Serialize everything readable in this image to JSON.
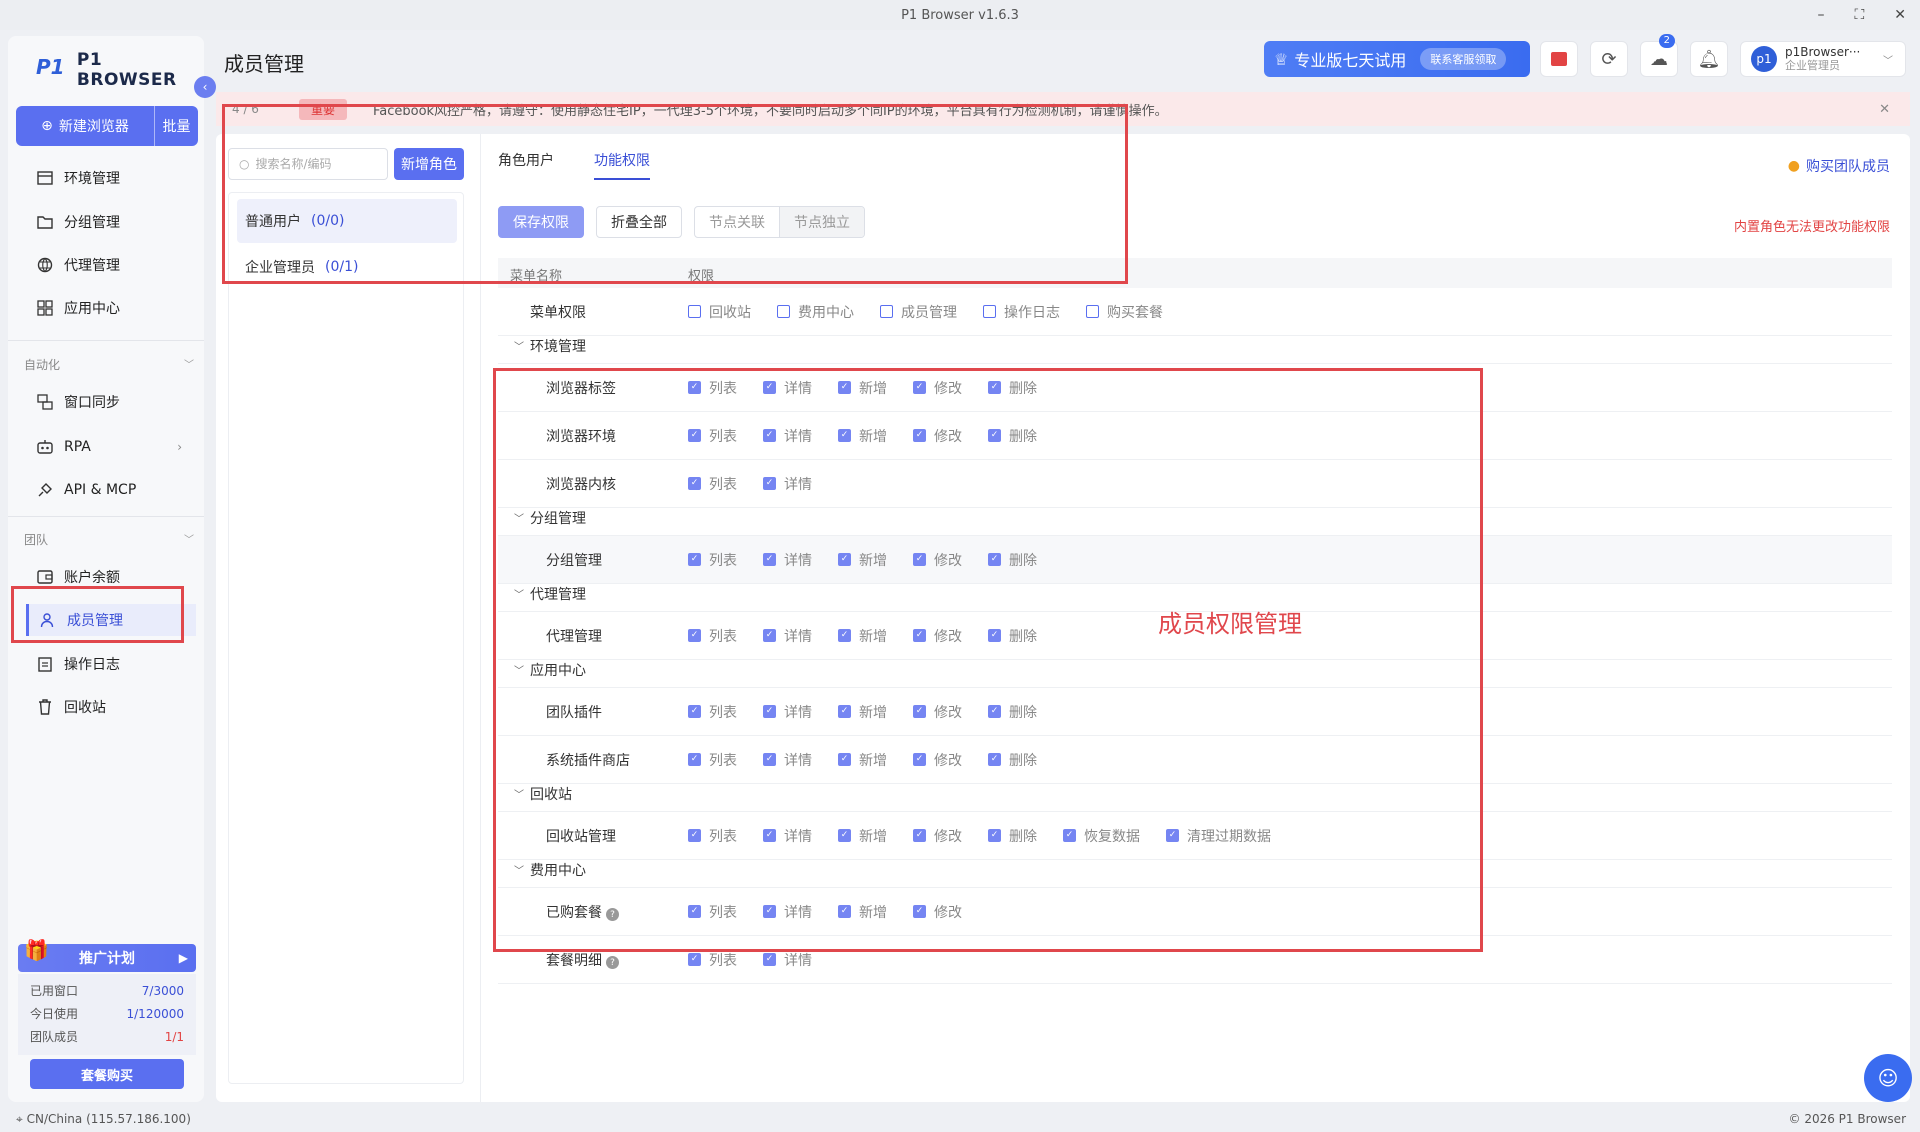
{
  "window": {
    "title": "P1 Browser v1.6.3",
    "min": "–",
    "max": "⛶",
    "close": "✕"
  },
  "sidebar": {
    "logo_text": "P1 BROWSER",
    "logo_mark": "P1",
    "new_browser": "新建浏览器",
    "batch": "批量",
    "items": [
      {
        "label": "环境管理",
        "icon": "browser-icon"
      },
      {
        "label": "分组管理",
        "icon": "folder-icon"
      },
      {
        "label": "代理管理",
        "icon": "globe-icon"
      },
      {
        "label": "应用中心",
        "icon": "grid-icon"
      }
    ],
    "automation": {
      "label": "自动化",
      "items": [
        "窗口同步",
        "RPA",
        "API & MCP"
      ]
    },
    "team": {
      "label": "团队",
      "items": [
        "账户余额",
        "成员管理",
        "操作日志",
        "回收站"
      ]
    },
    "promo": {
      "title": "推广计划",
      "rows": [
        {
          "k": "已用窗口",
          "v": "7/3000"
        },
        {
          "k": "今日使用",
          "v": "1/120000"
        },
        {
          "k": "团队成员",
          "v": "1/1"
        }
      ],
      "buy": "套餐购买"
    }
  },
  "header": {
    "title": "成员管理",
    "trial": "专业版七天试用",
    "contact": "联系客服领取",
    "cloud_badge": "2",
    "user_name": "p1Browser···",
    "user_role": "企业管理员",
    "avatar": "p1"
  },
  "notice": {
    "index": "4 / 6",
    "tag": "重要",
    "message": "Facebook风控严格，请遵守：使用静态住宅IP，一代理3-5个环境，不要同时启动多个同IP的环境，平台具有行为检测机制，请谨慎操作。",
    "close": "✕"
  },
  "roles": {
    "search_placeholder": "搜索名称/编码",
    "add_role": "新增角色",
    "list": [
      {
        "name": "普通用户",
        "count": "(0/0)"
      },
      {
        "name": "企业管理员",
        "count": "(0/1)"
      }
    ]
  },
  "tabs": [
    "角色用户",
    "功能权限"
  ],
  "buy_team": "购买团队成员",
  "toolbar": {
    "save": "保存权限",
    "collapse": "折叠全部",
    "link": "节点关联",
    "independent": "节点独立"
  },
  "warning": "内置角色无法更改功能权限",
  "perm_header": {
    "menu": "菜单名称",
    "perm": "权限"
  },
  "perms": {
    "menu_row": {
      "label": "菜单权限",
      "opts": [
        "回收站",
        "费用中心",
        "成员管理",
        "操作日志",
        "购买套餐"
      ]
    },
    "groups": [
      {
        "name": "环境管理",
        "rows": [
          {
            "label": "浏览器标签",
            "opts": [
              "列表",
              "详情",
              "新增",
              "修改",
              "删除"
            ]
          },
          {
            "label": "浏览器环境",
            "opts": [
              "列表",
              "详情",
              "新增",
              "修改",
              "删除"
            ]
          },
          {
            "label": "浏览器内核",
            "opts": [
              "列表",
              "详情"
            ]
          }
        ]
      },
      {
        "name": "分组管理",
        "rows": [
          {
            "label": "分组管理",
            "opts": [
              "列表",
              "详情",
              "新增",
              "修改",
              "删除"
            ]
          }
        ]
      },
      {
        "name": "代理管理",
        "rows": [
          {
            "label": "代理管理",
            "opts": [
              "列表",
              "详情",
              "新增",
              "修改",
              "删除"
            ]
          }
        ]
      },
      {
        "name": "应用中心",
        "rows": [
          {
            "label": "团队插件",
            "opts": [
              "列表",
              "详情",
              "新增",
              "修改",
              "删除"
            ]
          },
          {
            "label": "系统插件商店",
            "opts": [
              "列表",
              "详情",
              "新增",
              "修改",
              "删除"
            ]
          }
        ]
      },
      {
        "name": "回收站",
        "rows": [
          {
            "label": "回收站管理",
            "opts": [
              "列表",
              "详情",
              "新增",
              "修改",
              "删除",
              "恢复数据",
              "清理过期数据"
            ]
          }
        ]
      },
      {
        "name": "费用中心",
        "rows": [
          {
            "label": "已购套餐",
            "opts": [
              "列表",
              "详情",
              "新增",
              "修改"
            ]
          },
          {
            "label": "套餐明细",
            "opts": [
              "列表",
              "详情"
            ]
          }
        ]
      }
    ]
  },
  "annotation_text": "成员权限管理",
  "footer": {
    "location": "CN/China (115.57.186.100)",
    "copyright": "© 2026 P1 Browser"
  },
  "colors": {
    "accent": "#5a6ff0",
    "annotation": "#e0474c",
    "warning": "#e24444"
  }
}
